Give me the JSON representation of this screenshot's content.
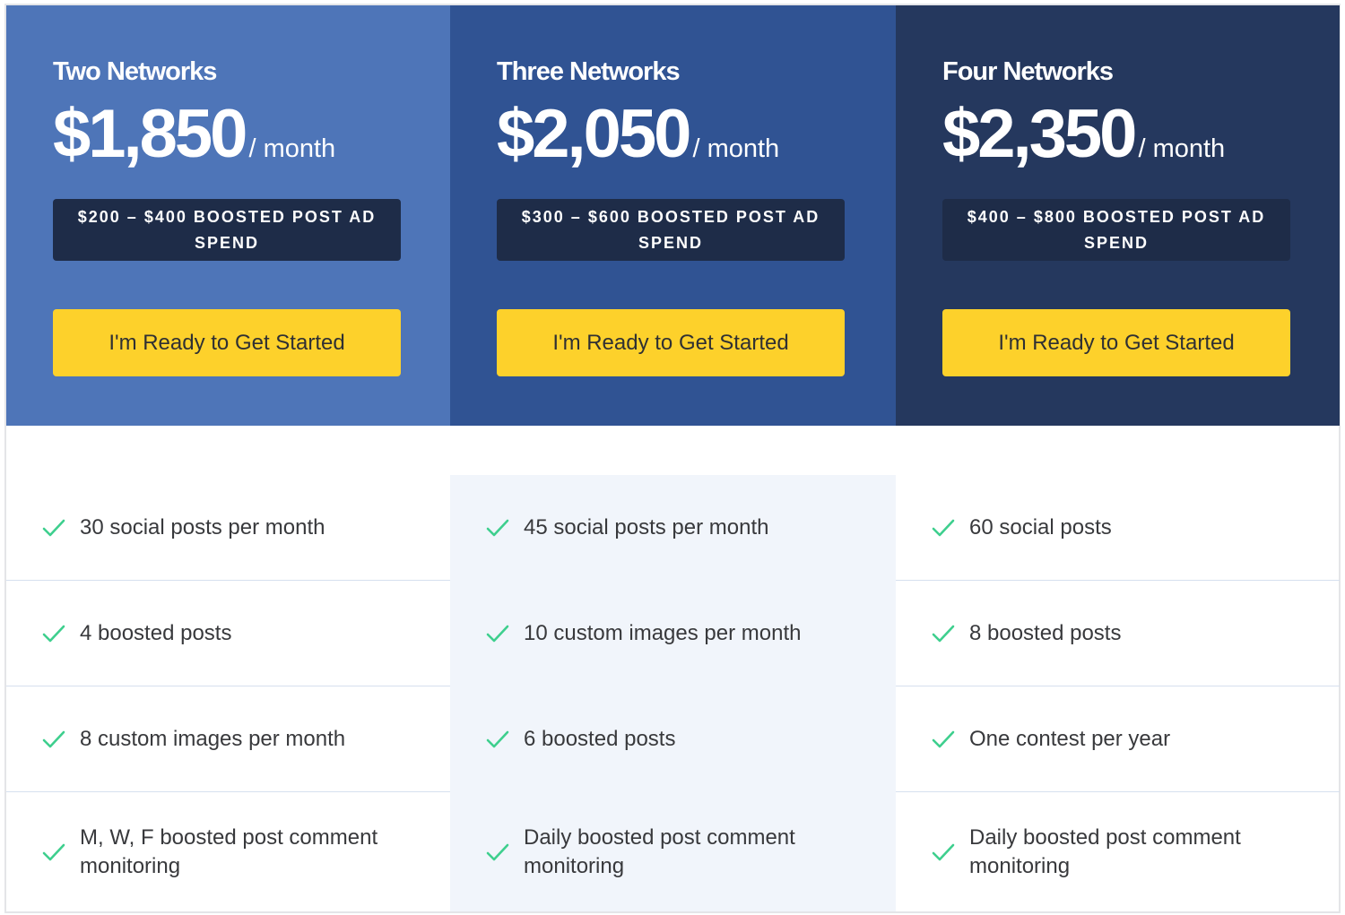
{
  "plans": [
    {
      "name": "Two Networks",
      "price": "$1,850",
      "period": "/ month",
      "ad_spend": "$200 – $400 BOOSTED POST AD SPEND",
      "cta_label": "I'm Ready to Get Started",
      "header_color": "#4e75b8",
      "features": [
        "30 social posts per month",
        "4 boosted posts",
        "8 custom images per month",
        "M, W, F boosted post comment monitoring"
      ]
    },
    {
      "name": "Three Networks",
      "price": "$2,050",
      "period": "/ month",
      "ad_spend": "$300 – $600 BOOSTED POST AD SPEND",
      "cta_label": "I'm Ready to Get Started",
      "header_color": "#305393",
      "features": [
        "45 social posts per month",
        "10 custom images per month",
        "6 boosted posts",
        "Daily boosted post comment monitoring"
      ]
    },
    {
      "name": "Four Networks",
      "price": "$2,350",
      "period": "/ month",
      "ad_spend": "$400 – $800 BOOSTED POST AD SPEND",
      "cta_label": "I'm Ready to Get Started",
      "header_color": "#25385e",
      "features": [
        "60 social posts",
        "8 boosted posts",
        "One contest per year",
        "Daily boosted post comment monitoring"
      ]
    }
  ],
  "colors": {
    "cta_bg": "#fdd12b",
    "badge_bg": "#1e2c48",
    "check": "#3ecf8e",
    "highlight_col_bg": "#f1f5fb"
  }
}
